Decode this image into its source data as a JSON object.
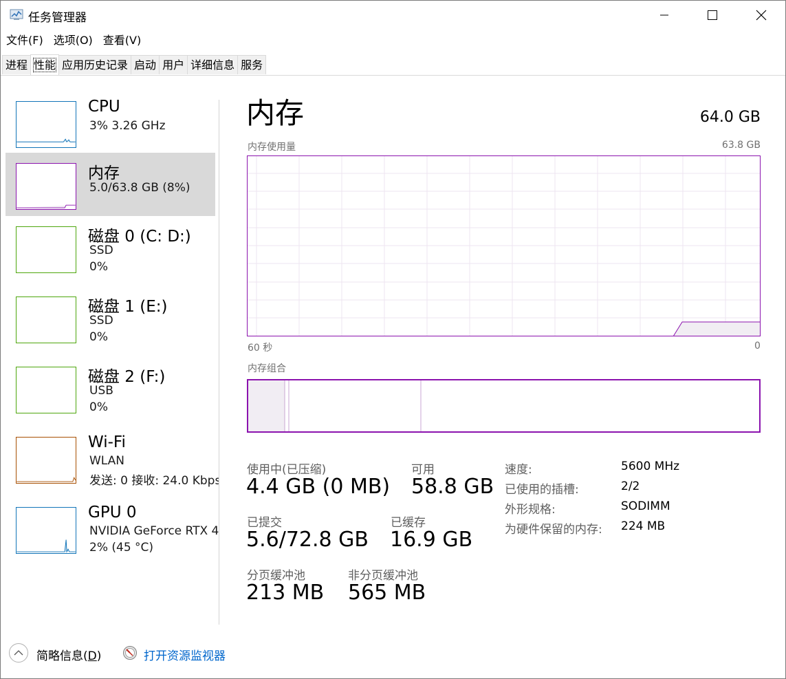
{
  "window": {
    "title": "任务管理器",
    "minimize_glyph": "—",
    "maximize_glyph": "☐",
    "close_glyph": "✕"
  },
  "menu": [
    "文件(F)",
    "选项(O)",
    "查看(V)"
  ],
  "tabs": [
    {
      "label": "进程",
      "active": false
    },
    {
      "label": "性能",
      "active": true
    },
    {
      "label": "应用历史记录",
      "active": false
    },
    {
      "label": "启动",
      "active": false
    },
    {
      "label": "用户",
      "active": false
    },
    {
      "label": "详细信息",
      "active": false
    },
    {
      "label": "服务",
      "active": false
    }
  ],
  "sidebar": {
    "items": [
      {
        "name": "CPU",
        "line1": "3%  3.26 GHz",
        "line2": "",
        "color": "#1174b8",
        "selected": false
      },
      {
        "name": "内存",
        "line1": "5.0/63.8 GB (8%)",
        "line2": "",
        "color": "#8b12ae",
        "selected": true
      },
      {
        "name": "磁盘 0 (C: D:)",
        "line1": "SSD",
        "line2": "0%",
        "color": "#4da60c",
        "selected": false
      },
      {
        "name": "磁盘 1 (E:)",
        "line1": "SSD",
        "line2": "0%",
        "color": "#4da60c",
        "selected": false
      },
      {
        "name": "磁盘 2 (F:)",
        "line1": "USB",
        "line2": "0%",
        "color": "#4da60c",
        "selected": false
      },
      {
        "name": "Wi-Fi",
        "line1": "WLAN",
        "line2": "发送: 0 接收: 24.0 Kbps",
        "color": "#a74f01",
        "selected": false
      },
      {
        "name": "GPU 0",
        "line1": "NVIDIA GeForce RTX 4",
        "line2": "2%  (45 °C)",
        "color": "#1174b8",
        "selected": false
      }
    ]
  },
  "main": {
    "title": "内存",
    "total": "64.0 GB",
    "usage_label": "内存使用量",
    "usage_max": "63.8 GB",
    "time_left": "60 秒",
    "time_right": "0",
    "composition_label": "内存组合",
    "stats": {
      "in_use_label": "使用中(已压缩)",
      "in_use_value": "4.4 GB (0 MB)",
      "available_label": "可用",
      "available_value": "58.8 GB",
      "committed_label": "已提交",
      "committed_value": "5.6/72.8 GB",
      "cached_label": "已缓存",
      "cached_value": "16.9 GB",
      "paged_label": "分页缓冲池",
      "paged_value": "213 MB",
      "nonpaged_label": "非分页缓冲池",
      "nonpaged_value": "565 MB"
    },
    "details": {
      "speed_label": "速度:",
      "speed_value": "5600 MHz",
      "slots_label": "已使用的插槽:",
      "slots_value": "2/2",
      "form_label": "外形规格:",
      "form_value": "SODIMM",
      "reserved_label": "为硬件保留的内存:",
      "reserved_value": "224 MB"
    },
    "accent_color": "#8b12ae",
    "fill_color": "#f1edf3"
  },
  "footer": {
    "fewer_details_prefix": "简略信息(",
    "fewer_details_key": "D",
    "fewer_details_suffix": ")",
    "resource_monitor": "打开资源监视器"
  }
}
